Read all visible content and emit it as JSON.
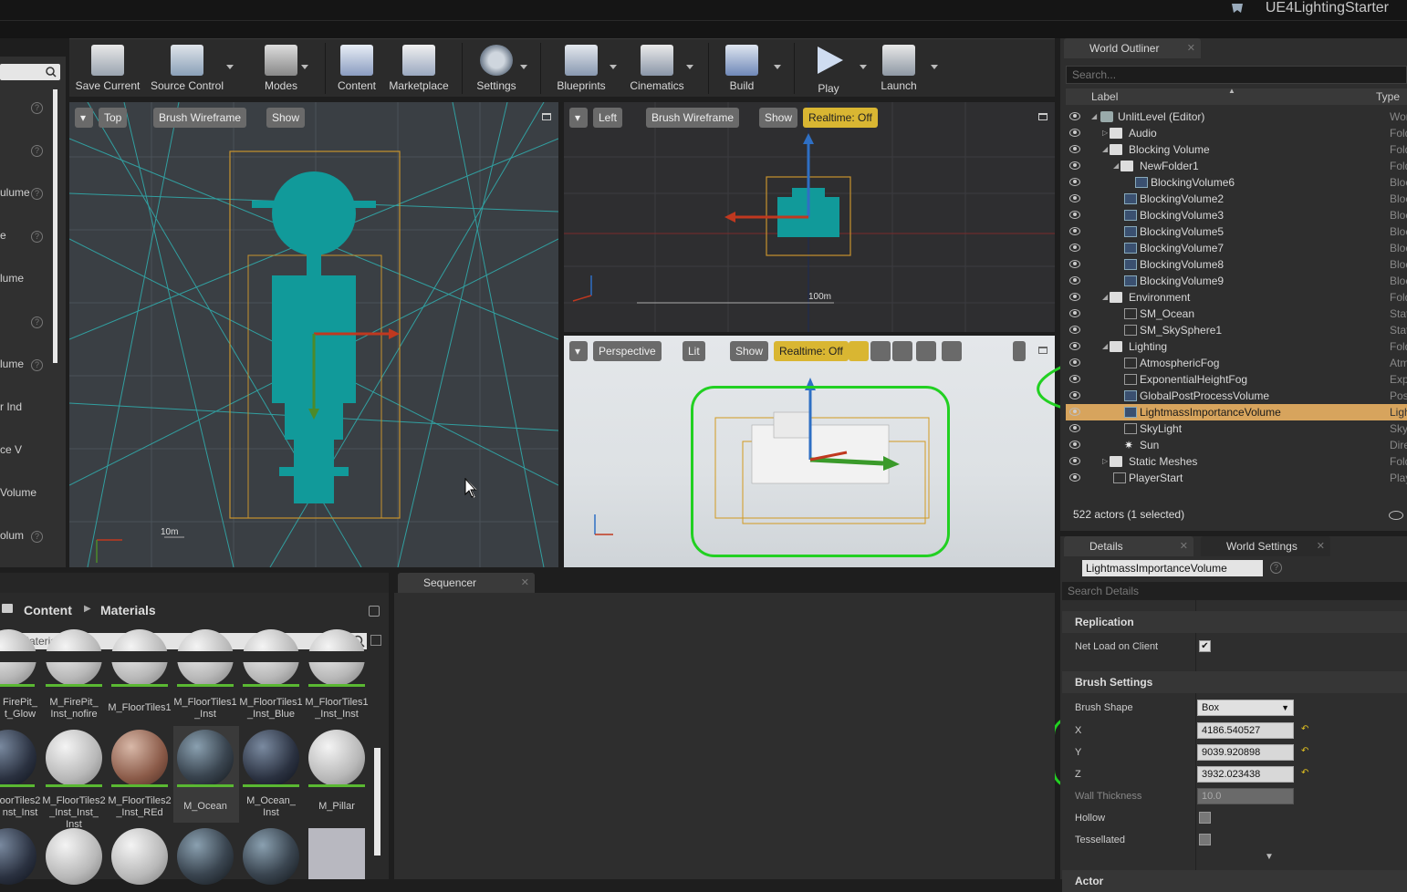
{
  "app": {
    "project_name": "UE4LightingStarter"
  },
  "left_panel": {
    "items": [
      "",
      "",
      "ulume",
      "e",
      "lume",
      "",
      "lume",
      "r Ind",
      "ce V",
      "Volume",
      "olum"
    ]
  },
  "toolbar": {
    "save_current": "Save Current",
    "source_control": "Source Control",
    "modes": "Modes",
    "content": "Content",
    "marketplace": "Marketplace",
    "settings": "Settings",
    "blueprints": "Blueprints",
    "cinematics": "Cinematics",
    "build": "Build",
    "play": "Play",
    "launch": "Launch"
  },
  "viewport_top": {
    "view": "Top",
    "mode": "Brush Wireframe",
    "show": "Show",
    "scale": "10m"
  },
  "viewport_left": {
    "view": "Left",
    "mode": "Brush Wireframe",
    "show": "Show",
    "realtime": "Realtime: Off",
    "scale": "100m"
  },
  "viewport_persp": {
    "view": "Perspective",
    "lit": "Lit",
    "show": "Show",
    "realtime": "Realtime: Off"
  },
  "outliner": {
    "tab": "World Outliner",
    "search_placeholder": "Search...",
    "col_label": "Label",
    "col_type": "Type",
    "rows": [
      {
        "label": "UnlitLevel (Editor)",
        "type": "World"
      },
      {
        "label": "Audio",
        "type": "Folder"
      },
      {
        "label": "Blocking Volume",
        "type": "Folder"
      },
      {
        "label": "NewFolder1",
        "type": "Folder"
      },
      {
        "label": "BlockingVolume6",
        "type": "Blockin"
      },
      {
        "label": "BlockingVolume2",
        "type": "Blockin"
      },
      {
        "label": "BlockingVolume3",
        "type": "Blockin"
      },
      {
        "label": "BlockingVolume5",
        "type": "Blockin"
      },
      {
        "label": "BlockingVolume7",
        "type": "Blockin"
      },
      {
        "label": "BlockingVolume8",
        "type": "Blockin"
      },
      {
        "label": "BlockingVolume9",
        "type": "Blockin"
      },
      {
        "label": "Environment",
        "type": "Folder"
      },
      {
        "label": "SM_Ocean",
        "type": "StaticM"
      },
      {
        "label": "SM_SkySphere1",
        "type": "StaticM"
      },
      {
        "label": "Lighting",
        "type": "Folder"
      },
      {
        "label": "AtmosphericFog",
        "type": "Atmosp"
      },
      {
        "label": "ExponentialHeightFog",
        "type": "Expone"
      },
      {
        "label": "GlobalPostProcessVolume",
        "type": "PostPr"
      },
      {
        "label": "LightmassImportanceVolume",
        "type": "Lightm"
      },
      {
        "label": "SkyLight",
        "type": "SkyLigh"
      },
      {
        "label": "Sun",
        "type": "Directio"
      },
      {
        "label": "Static Meshes",
        "type": "Folder"
      },
      {
        "label": "PlayerStart",
        "type": "PlayerS"
      }
    ],
    "actors_status": "522 actors (1 selected)"
  },
  "details": {
    "tab": "Details",
    "tab2": "World Settings",
    "object_name": "LightmassImportanceVolume",
    "search_placeholder": "Search Details",
    "replication": "Replication",
    "net_load_label": "Net Load on Client",
    "brush_settings": "Brush Settings",
    "brush_shape_label": "Brush Shape",
    "brush_shape": "Box",
    "x_label": "X",
    "x": "4186.540527",
    "y_label": "Y",
    "y": "9039.920898",
    "z_label": "Z",
    "z": "3932.023438",
    "wall_label": "Wall Thickness",
    "wall": "10.0",
    "hollow_label": "Hollow",
    "tess_label": "Tessellated",
    "actor": "Actor"
  },
  "content_browser": {
    "root": "Content",
    "folder": "Materials",
    "search_placeholder": "rch Materials",
    "items": [
      "FirePit_\nt_Glow",
      "M_FirePit_\nInst_nofire",
      "M_FloorTiles1",
      "M_FloorTiles1\n_Inst",
      "M_FloorTiles1\n_Inst_Blue",
      "M_FloorTiles1\n_Inst_Inst",
      "oorTiles2\nnst_Inst",
      "M_FloorTiles2\n_Inst_Inst_\nInst",
      "M_FloorTiles2\n_Inst_REd",
      "M_Ocean",
      "M_Ocean_\nInst",
      "M_Pillar"
    ]
  },
  "sequencer": {
    "tab": "Sequencer"
  },
  "colors": {
    "accent": "#d9b632",
    "selection": "#d7a45d",
    "annotation": "#22d022"
  }
}
